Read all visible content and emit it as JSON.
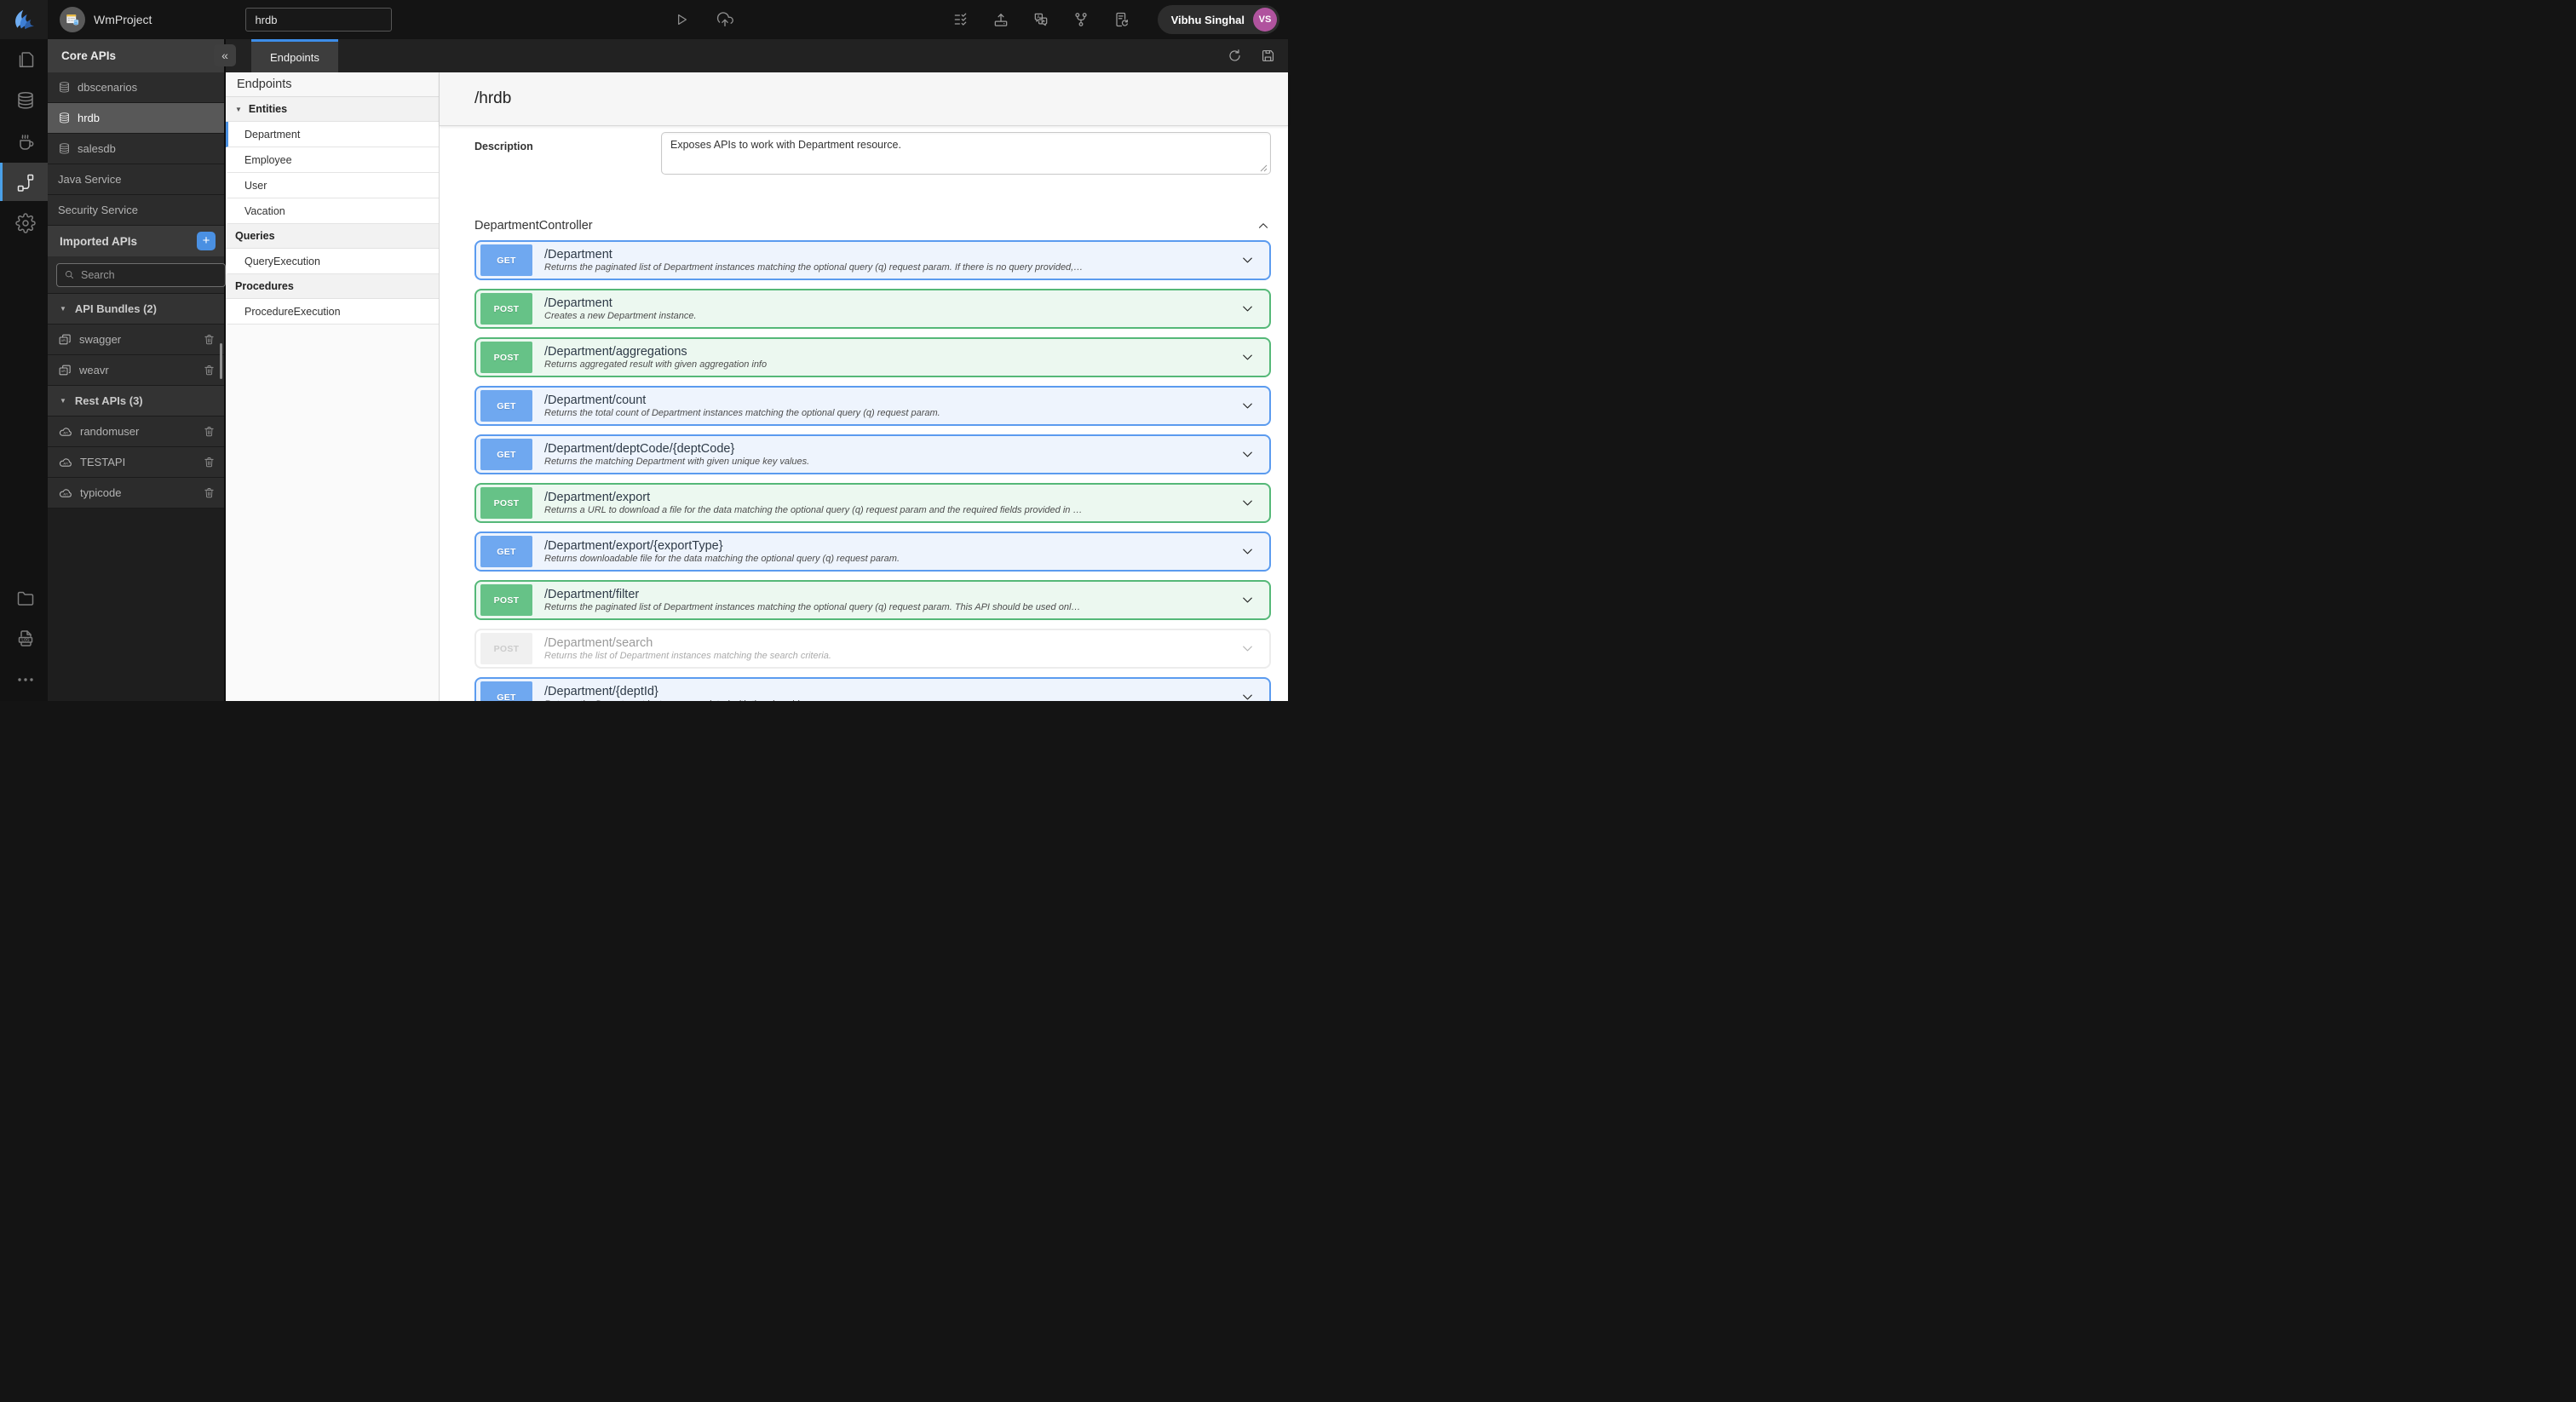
{
  "icons": {
    "collapse": "«",
    "caret_down": "▼",
    "add": "+",
    "api_label": "API",
    "log_label": "LOG"
  },
  "colors": {
    "accent_blue": "#4A90E2",
    "get_badge": "#6FA8F0",
    "get_border": "#5B9BEF",
    "get_bg": "#EEF4FD",
    "post_badge": "#66C287",
    "post_border": "#55B878",
    "post_bg": "#ECF8F0",
    "disabled_badge": "#F0F0F0",
    "avatar_bg": "#B0539E"
  },
  "topbar": {
    "project_name": "WmProject",
    "search_value": "hrdb",
    "user_name": "Vibhu Singhal",
    "user_initials": "VS"
  },
  "sidebar": {
    "title": "Core APIs",
    "core_items": [
      {
        "label": "dbscenarios",
        "db_icon": true
      },
      {
        "label": "hrdb",
        "db_icon": true,
        "selected": true
      },
      {
        "label": "salesdb",
        "db_icon": true
      },
      {
        "label": "Java Service"
      },
      {
        "label": "Security Service"
      }
    ],
    "imported_header": "Imported APIs",
    "search_placeholder": "Search",
    "bundles_header": "API Bundles (2)",
    "bundles": [
      {
        "label": "swagger"
      },
      {
        "label": "weavr"
      }
    ],
    "rest_header": "Rest APIs (3)",
    "rest_apis": [
      {
        "label": "randomuser"
      },
      {
        "label": "TESTAPI"
      },
      {
        "label": "typicode"
      }
    ]
  },
  "tabs": {
    "active_label": "Endpoints"
  },
  "endpoints_panel": {
    "title": "Endpoints",
    "entities_header": "Entities",
    "entities": [
      {
        "label": "Department",
        "selected": true
      },
      {
        "label": "Employee"
      },
      {
        "label": "User"
      },
      {
        "label": "Vacation"
      }
    ],
    "queries_header": "Queries",
    "queries": [
      {
        "label": "QueryExecution"
      }
    ],
    "procedures_header": "Procedures",
    "procedures": [
      {
        "label": "ProcedureExecution"
      }
    ]
  },
  "main": {
    "path_title": "/hrdb",
    "description_label": "Description",
    "description_value": "Exposes APIs to work with Department resource.",
    "controller_name": "DepartmentController",
    "endpoints": [
      {
        "method": "GET",
        "path": "/Department",
        "desc": "Returns the paginated list of Department instances matching the optional query (q) request param. If there is no query provided,…"
      },
      {
        "method": "POST",
        "path": "/Department",
        "desc": "Creates a new Department instance."
      },
      {
        "method": "POST",
        "path": "/Department/aggregations",
        "desc": "Returns aggregated result with given aggregation info"
      },
      {
        "method": "GET",
        "path": "/Department/count",
        "desc": "Returns the total count of Department instances matching the optional query (q) request param."
      },
      {
        "method": "GET",
        "path": "/Department/deptCode/{deptCode}",
        "desc": "Returns the matching Department with given unique key values."
      },
      {
        "method": "POST",
        "path": "/Department/export",
        "desc": "Returns a URL to download a file for the data matching the optional query (q) request param and the required fields provided in …"
      },
      {
        "method": "GET",
        "path": "/Department/export/{exportType}",
        "desc": "Returns downloadable file for the data matching the optional query (q) request param."
      },
      {
        "method": "POST",
        "path": "/Department/filter",
        "desc": "Returns the paginated list of Department instances matching the optional query (q) request param. This API should be used onl…"
      },
      {
        "method": "POST",
        "path": "/Department/search",
        "desc": "Returns the list of Department instances matching the search criteria.",
        "disabled": true
      },
      {
        "method": "GET",
        "path": "/Department/{deptId}",
        "desc": "Returns the Department instance associated with the given id."
      }
    ]
  }
}
